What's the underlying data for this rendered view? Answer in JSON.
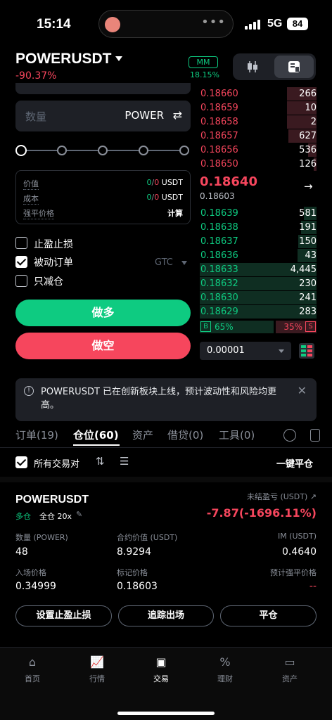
{
  "status": {
    "time": "15:14",
    "network": "5G",
    "battery": "84"
  },
  "header": {
    "symbol": "POWERUSDT",
    "change": "-90.37%",
    "mm_label": "MM",
    "mm_value": "18.15%"
  },
  "order_form": {
    "qty_placeholder": "数量",
    "qty_unit": "POWER",
    "info": [
      {
        "label": "价值",
        "v1": "0",
        "sep": "/",
        "v2": "0",
        "unit": " USDT"
      },
      {
        "label": "成本",
        "v1": "0",
        "sep": "/",
        "v2": "0",
        "unit": " USDT"
      },
      {
        "label": "强平价格",
        "v1": "",
        "sep": "",
        "v2": "",
        "unit": "计算"
      }
    ],
    "options": [
      {
        "label": "止盈止损",
        "checked": false
      },
      {
        "label": "被动订单",
        "checked": true
      },
      {
        "label": "只减仓",
        "checked": false
      }
    ],
    "tif": "GTC",
    "buy_label": "做多",
    "sell_label": "做空"
  },
  "orderbook": {
    "asks": [
      [
        "0.18660",
        "266"
      ],
      [
        "0.18659",
        "10"
      ],
      [
        "0.18658",
        "2"
      ],
      [
        "0.18657",
        "627"
      ],
      [
        "0.18656",
        "536"
      ],
      [
        "0.18650",
        "126"
      ]
    ],
    "mid_price": "0.18640",
    "mark_price": "0.18603",
    "bids": [
      [
        "0.18639",
        "581"
      ],
      [
        "0.18638",
        "191"
      ],
      [
        "0.18637",
        "150"
      ],
      [
        "0.18636",
        "43"
      ],
      [
        "0.18633",
        "4,445"
      ],
      [
        "0.18632",
        "230"
      ],
      [
        "0.18630",
        "241"
      ],
      [
        "0.18629",
        "283"
      ]
    ],
    "buy_ratio": "65%",
    "sell_ratio": "35%",
    "b_label": "B",
    "s_label": "S",
    "precision": "0.00001"
  },
  "notice": {
    "text": "POWERUSDT 已在创新板块上线，预计波动性和风险均更高。"
  },
  "tabs": [
    {
      "label": "订单(19)"
    },
    {
      "label": "仓位(60)"
    },
    {
      "label": "资产"
    },
    {
      "label": "借贷(0)"
    },
    {
      "label": "工具(0)"
    }
  ],
  "filter": {
    "label": "所有交易对",
    "close_all": "一键平仓"
  },
  "position": {
    "symbol": "POWERUSDT",
    "side": "多仓",
    "leverage": "全仓 20x",
    "upl_label": "未结盈亏 (USDT)",
    "upl_value": "-7.87(-1696.11%)",
    "fields": [
      {
        "label": "数量 (POWER)",
        "value": "48"
      },
      {
        "label": "合约价值 (USDT)",
        "value": "8.9294"
      },
      {
        "label": "IM (USDT)",
        "value": "0.4640"
      },
      {
        "label": "入场价格",
        "value": "0.34999"
      },
      {
        "label": "标记价格",
        "value": "0.18603"
      },
      {
        "label": "预计强平价格",
        "value": "--"
      }
    ],
    "buttons": [
      "设置止盈止损",
      "追踪出场",
      "平仓"
    ]
  },
  "nav": [
    {
      "label": "首页"
    },
    {
      "label": "行情"
    },
    {
      "label": "交易"
    },
    {
      "label": "理财"
    },
    {
      "label": "资产"
    }
  ]
}
